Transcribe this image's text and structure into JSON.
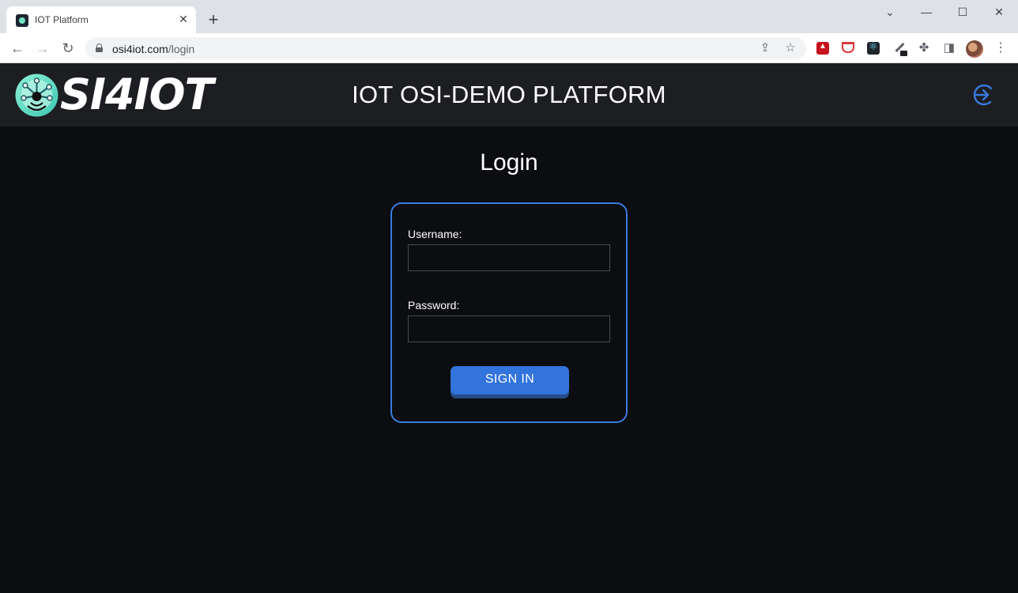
{
  "browser": {
    "tab_title": "IOT Platform",
    "tab_close": "✕",
    "new_tab": "+",
    "url_host": "osi4iot.com",
    "url_path": "/login",
    "window_controls": {
      "minimize": "—",
      "maximize": "☐",
      "close": "✕",
      "tab_search": "⌄"
    },
    "icons": [
      "back-arrow-icon",
      "forward-arrow-icon",
      "reload-icon",
      "lock-icon",
      "share-icon",
      "bookmark-star-icon",
      "pdf-extension-icon",
      "shield-extension-icon",
      "react-devtools-icon",
      "color-picker-extension-icon",
      "extensions-puzzle-icon",
      "side-panel-icon",
      "profile-avatar",
      "menu-dots-icon"
    ]
  },
  "header": {
    "logo_text": "SI4IOT",
    "title": "IOT OSI-DEMO PLATFORM",
    "accent_color": "#3a7be0"
  },
  "login": {
    "heading": "Login",
    "username_label": "Username:",
    "username_value": "",
    "password_label": "Password:",
    "password_value": "",
    "submit_label": "SIGN IN"
  },
  "colors": {
    "page_background": "#0c0d10",
    "header_background": "#1d1e22",
    "button": "#3273dc",
    "card_border": "#3a7be0"
  }
}
